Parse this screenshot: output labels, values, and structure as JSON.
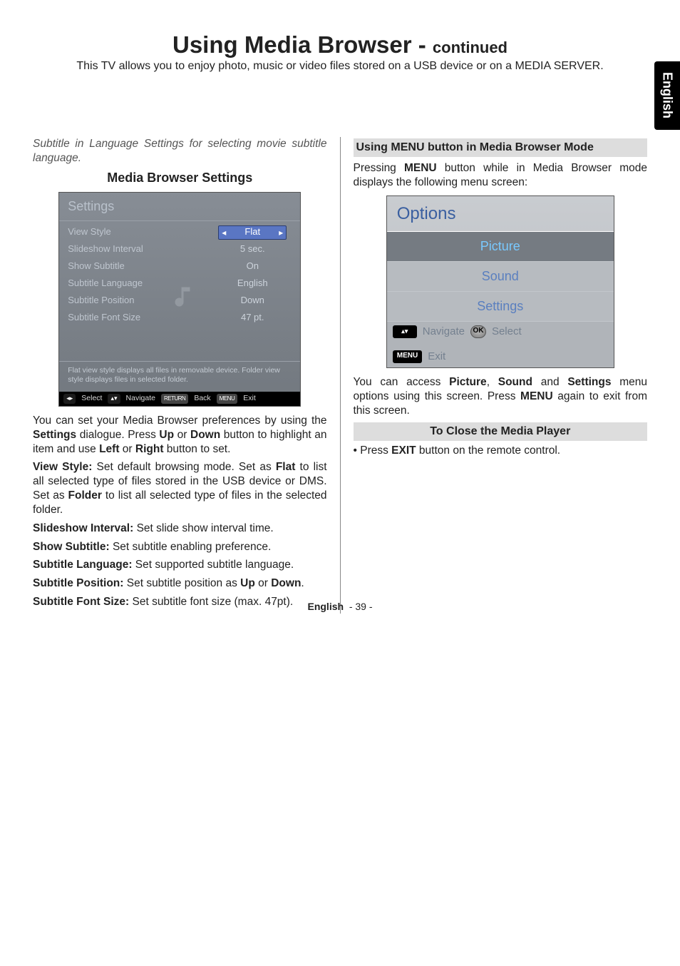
{
  "title_main": "Using Media Browser - ",
  "title_cont": "continued",
  "subtitle": "This TV allows you to enjoy photo, music or video files stored on a USB device or on a MEDIA SERVER.",
  "side_tab": "English",
  "left": {
    "italic_note": "Subtitle in Language Settings for selecting movie subtitle language.",
    "heading": "Media Browser Settings",
    "settings_shot": {
      "header": "Settings",
      "rows": [
        {
          "label": "View Style",
          "value": "Flat",
          "selected": true
        },
        {
          "label": "Slideshow Interval",
          "value": "5 sec."
        },
        {
          "label": "Show Subtitle",
          "value": "On"
        },
        {
          "label": "Subtitle Language",
          "value": "English"
        },
        {
          "label": "Subtitle Position",
          "value": "Down"
        },
        {
          "label": "Subtitle Font Size",
          "value": "47 pt."
        }
      ],
      "description": "Flat view style displays all files in removable device. Folder view style displays files in selected folder.",
      "footer": {
        "select": "Select",
        "navigate": "Navigate",
        "back_key": "RETURN",
        "back": "Back",
        "exit_key": "MENU",
        "exit": "Exit"
      }
    },
    "p_prefs": "You can set your Media Browser preferences by using the ",
    "p_prefs_b1": "Settings",
    "p_prefs_mid1": " dialogue. Press ",
    "p_prefs_b2": "Up",
    "p_prefs_mid2": " or ",
    "p_prefs_b3": "Down",
    "p_prefs_mid3": " button to highlight an item and use ",
    "p_prefs_b4": "Left",
    "p_prefs_mid4": " or ",
    "p_prefs_b5": "Right",
    "p_prefs_end": " button to set.",
    "vs_b": "View Style:",
    "vs_1": " Set default browsing mode. Set as ",
    "vs_b2": "Flat",
    "vs_2": " to list all selected type of files stored in the USB device or DMS. Set as ",
    "vs_b3": "Folder",
    "vs_3": " to list all selected type of files in the selected folder.",
    "si_b": "Slideshow Interval:",
    "si_t": " Set slide show interval time.",
    "ss_b": "Show Subtitle:",
    "ss_t": " Set subtitle enabling preference.",
    "sl_b": "Subtitle Language:",
    "sl_t": " Set supported subtitle language.",
    "sp_b": "Subtitle Position:",
    "sp_1": " Set subtitle position as ",
    "sp_b2": "Up",
    "sp_2": " or ",
    "sp_b3": "Down",
    "sp_3": ".",
    "sf_b": "Subtitle Font Size:",
    "sf_t": " Set subtitle font size (max. 47pt)."
  },
  "right": {
    "heading_menu": "Using MENU button in Media Browser Mode",
    "p_menu_1": "Pressing ",
    "p_menu_b1": "MENU",
    "p_menu_2": " button while in Media Browser mode displays the following menu screen:",
    "options_shot": {
      "header": "Options",
      "items": [
        {
          "label": "Picture",
          "selected": true
        },
        {
          "label": "Sound",
          "selected": false
        },
        {
          "label": "Settings",
          "selected": false
        }
      ],
      "footer": {
        "navigate": "Navigate",
        "ok": "OK",
        "select": "Select",
        "menu_key": "MENU",
        "exit": "Exit"
      }
    },
    "p_access_1": "You can access ",
    "p_access_b1": "Picture",
    "p_access_2": ", ",
    "p_access_b2": "Sound",
    "p_access_3": " and ",
    "p_access_b3": "Settings",
    "p_access_4": " menu options using this screen. Press ",
    "p_access_b4": "MENU",
    "p_access_5": " again to exit from this screen.",
    "heading_close": "To Close the Media Player",
    "close_1": "Press ",
    "close_b1": "EXIT",
    "close_2": " button on the remote control."
  },
  "footer": {
    "lang": "English",
    "page": "- 39 -"
  }
}
